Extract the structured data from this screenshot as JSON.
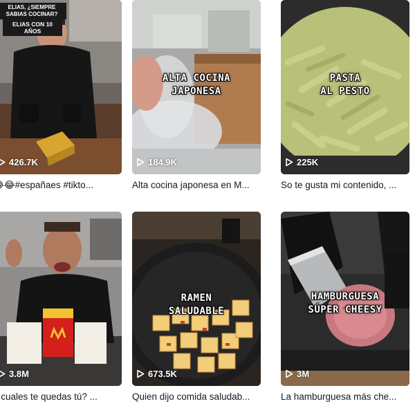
{
  "videos": [
    {
      "views": "426.7K",
      "caption": "😂😂#españaes #tikto...",
      "overlay_top": "ELIAS, ¿SIEMPRE SABIAS COCINAR?",
      "overlay_tag": "ELIAS CON 10 AÑOS",
      "overlay": ""
    },
    {
      "views": "184.9K",
      "caption": "Alta cocina japonesa en M...",
      "overlay_line1": "ALTA COCINA",
      "overlay_line2": "JAPONESA"
    },
    {
      "views": "225K",
      "caption": "So te gusta mi contenido, ...",
      "overlay_line1": "PASTA",
      "overlay_line2": "AL PESTO"
    },
    {
      "views": "3.8M",
      "caption": "n cuales te quedas tú? ...",
      "overlay_line1": "",
      "overlay_line2": ""
    },
    {
      "views": "673.5K",
      "caption": "Quien dijo comida saludab...",
      "overlay_line1": "RAMEN",
      "overlay_line2": "SALUDABLE"
    },
    {
      "views": "3M",
      "caption": "La hamburguesa más che...",
      "overlay_line1": "HAMBURGUESA",
      "overlay_line2": "SÚPER CHEESY"
    }
  ],
  "icons": {
    "play": "play-icon"
  },
  "colors": {
    "text": "#161823",
    "overlay_text": "#ffffff"
  }
}
